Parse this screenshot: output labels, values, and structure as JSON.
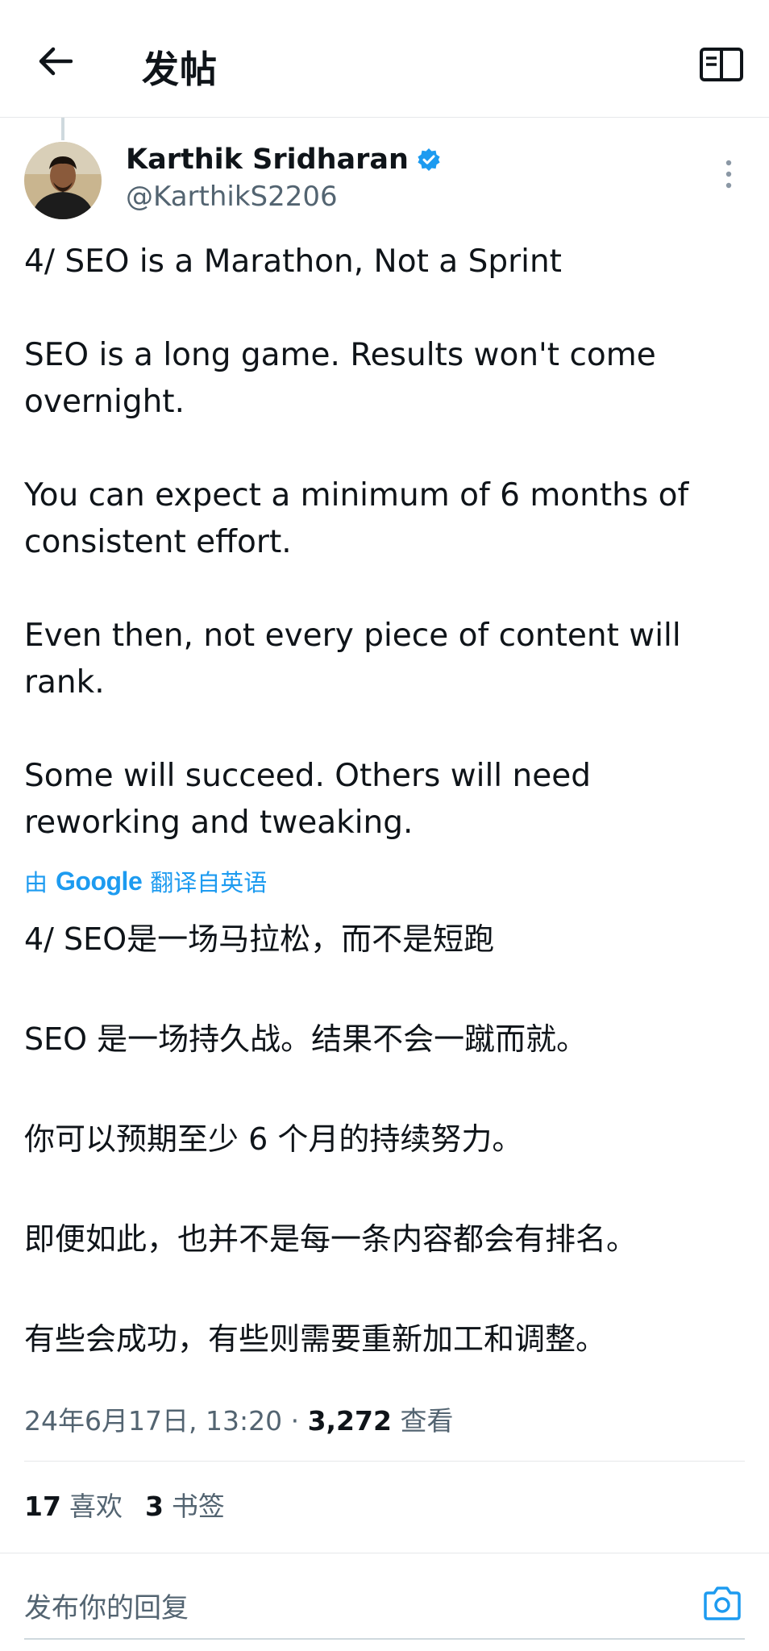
{
  "header": {
    "title": "发帖",
    "back_icon": "arrow-left-icon",
    "reader_icon": "book-open-icon"
  },
  "author": {
    "name": "Karthik Sridharan",
    "handle": "@KarthikS2206",
    "verified_color": "#1d9bf0"
  },
  "tweet": {
    "text": "4/ SEO is a Marathon, Not a Sprint\n\nSEO is a long game. Results won't come overnight.\n\nYou can expect a minimum of 6 months of consistent effort.\n\nEven then, not every piece of content will rank.\n\nSome will succeed. Others will need reworking and tweaking."
  },
  "translation": {
    "prefix": "由",
    "provider": "Google",
    "suffix": "翻译自英语",
    "text": "4/ SEO是一场马拉松，而不是短跑\n\nSEO 是一场持久战。结果不会一蹴而就。\n\n你可以预期至少 6 个月的持续努力。\n\n即便如此，也并不是每一条内容都会有排名。\n\n有些会成功，有些则需要重新加工和调整。"
  },
  "meta": {
    "timestamp": "24年6月17日, 13:20",
    "separator": "·",
    "views_count": "3,272",
    "views_label": "查看"
  },
  "stats": {
    "likes_count": "17",
    "likes_label": "喜欢",
    "bookmarks_count": "3",
    "bookmarks_label": "书签"
  },
  "reply": {
    "placeholder": "发布你的回复",
    "camera_icon": "camera-icon",
    "accent": "#1d9bf0"
  }
}
